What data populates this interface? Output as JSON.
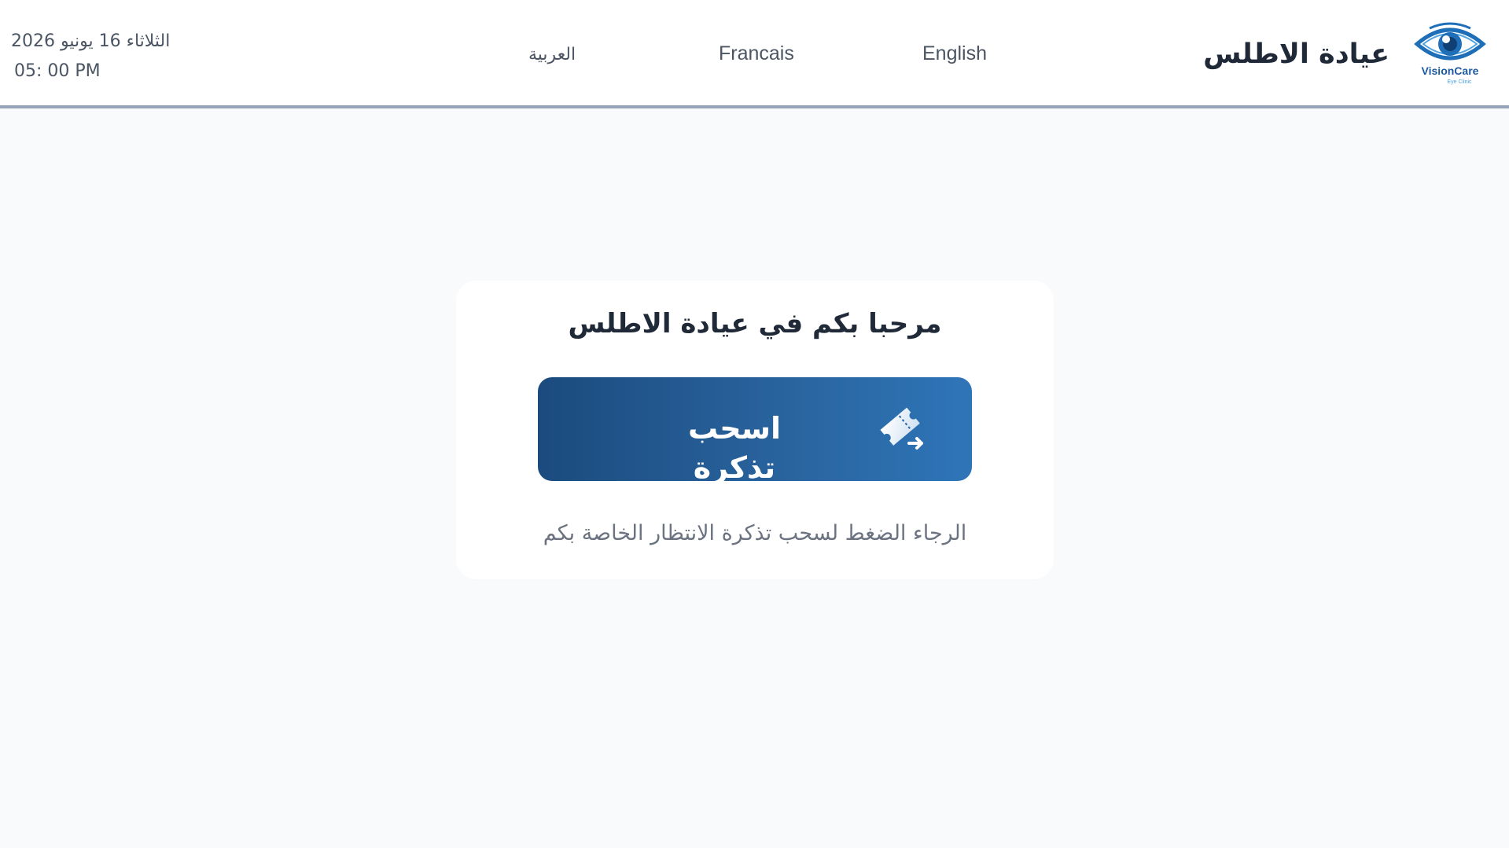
{
  "header": {
    "date": "الثلاثاء 16 يونيو 2026",
    "time": "05: 00 PM",
    "languages": [
      "العربية",
      "Francais",
      "English"
    ],
    "clinic_name": "عيادة الاطلس",
    "logo": {
      "icon": "eye-icon",
      "brand": "VisionCare",
      "tagline": "Eye Clinic"
    }
  },
  "main": {
    "welcome": "مرحبا بكم في عيادة الاطلس",
    "ticket_button_label": "اسحب تذكرة",
    "ticket_icon": "ticket-icon",
    "instruction": "الرجاء الضغط لسحب تذكرة الانتظار الخاصة بكم"
  },
  "colors": {
    "button_gradient_start": "#1b4b7e",
    "button_gradient_end": "#2e75b8",
    "header_border": "#94a3b8",
    "background": "#f8fafc",
    "logo_blue": "#1e6fb8"
  }
}
